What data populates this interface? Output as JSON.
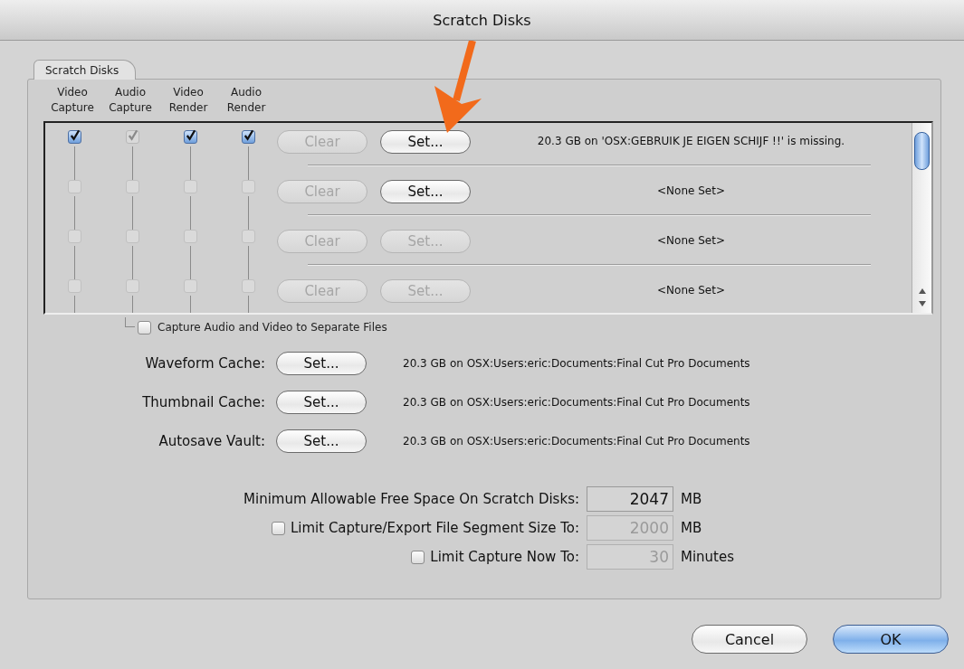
{
  "window": {
    "title": "Scratch Disks"
  },
  "tab": {
    "label": "Scratch Disks",
    "selected": true
  },
  "columns": [
    "Video Capture",
    "Audio Capture",
    "Video Render",
    "Audio Render"
  ],
  "disks": [
    {
      "checks": [
        {
          "checked": true,
          "disabled": false
        },
        {
          "checked": true,
          "disabled": true
        },
        {
          "checked": true,
          "disabled": false
        },
        {
          "checked": true,
          "disabled": false
        }
      ],
      "clear": {
        "label": "Clear",
        "disabled": true
      },
      "set": {
        "label": "Set...",
        "disabled": false
      },
      "info": "20.3 GB on  'OSX:GEBRUIK JE EIGEN SCHIJF !!' is missing."
    },
    {
      "checks": [
        {
          "checked": false,
          "disabled": true
        },
        {
          "checked": false,
          "disabled": true
        },
        {
          "checked": false,
          "disabled": true
        },
        {
          "checked": false,
          "disabled": true
        }
      ],
      "clear": {
        "label": "Clear",
        "disabled": true
      },
      "set": {
        "label": "Set...",
        "disabled": false
      },
      "info": "<None Set>"
    },
    {
      "checks": [
        {
          "checked": false,
          "disabled": true
        },
        {
          "checked": false,
          "disabled": true
        },
        {
          "checked": false,
          "disabled": true
        },
        {
          "checked": false,
          "disabled": true
        }
      ],
      "clear": {
        "label": "Clear",
        "disabled": true
      },
      "set": {
        "label": "Set...",
        "disabled": true
      },
      "info": "<None Set>"
    },
    {
      "checks": [
        {
          "checked": false,
          "disabled": true
        },
        {
          "checked": false,
          "disabled": true
        },
        {
          "checked": false,
          "disabled": true
        },
        {
          "checked": false,
          "disabled": true
        }
      ],
      "clear": {
        "label": "Clear",
        "disabled": true
      },
      "set": {
        "label": "Set...",
        "disabled": true
      },
      "info": "<None Set>"
    }
  ],
  "separate_files": {
    "label": "Capture Audio and Video to Separate Files",
    "checked": false
  },
  "caches": [
    {
      "label": "Waveform Cache:",
      "button": "Set...",
      "info": "20.3 GB on  OSX:Users:eric:Documents:Final Cut Pro Documents"
    },
    {
      "label": "Thumbnail Cache:",
      "button": "Set...",
      "info": "20.3 GB on  OSX:Users:eric:Documents:Final Cut Pro Documents"
    },
    {
      "label": "Autosave Vault:",
      "button": "Set...",
      "info": "20.3 GB on  OSX:Users:eric:Documents:Final Cut Pro Documents"
    }
  ],
  "limits": [
    {
      "kind": "plain",
      "label": "Minimum Allowable Free Space On Scratch Disks:",
      "value": "2047",
      "unit": "MB",
      "disabled": false
    },
    {
      "kind": "checkbox",
      "checked": false,
      "label": "Limit Capture/Export File Segment Size To:",
      "value": "2000",
      "unit": "MB",
      "disabled": true
    },
    {
      "kind": "checkbox",
      "checked": false,
      "label": "Limit Capture Now To:",
      "value": "30",
      "unit": "Minutes",
      "disabled": true
    }
  ],
  "buttons": [
    {
      "label": "Cancel",
      "default": false
    },
    {
      "label": "OK",
      "default": true
    }
  ]
}
